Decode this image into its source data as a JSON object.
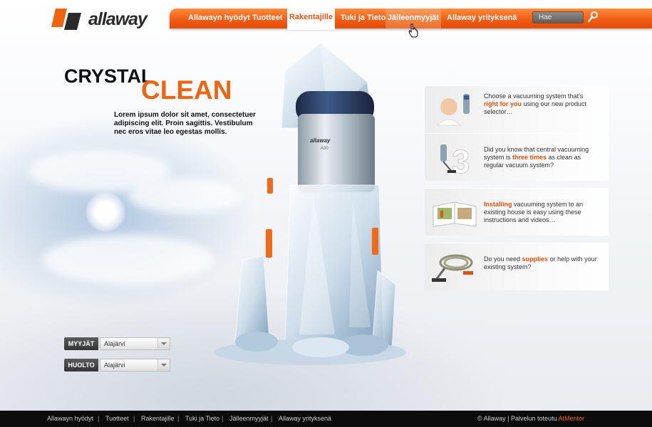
{
  "brand": {
    "name": "allaway"
  },
  "nav": {
    "items": [
      {
        "label": "Allawayn hyödyt"
      },
      {
        "label": "Tuotteet"
      },
      {
        "label": "Rakentajille"
      },
      {
        "label": "Tuki ja Tieto"
      },
      {
        "label": "Jälleenmyyjät"
      },
      {
        "label": "Allaway yrityksenä"
      }
    ],
    "active": "Rakentajille",
    "hover": "Jälleenmyyjät"
  },
  "search": {
    "placeholder": "Hae"
  },
  "hero": {
    "title_line1": "CRYSTAL",
    "title_line2": "CLEAN",
    "body": "Lorem ipsum dolor sit amet, consectetuer adipiscing elit. Proin sagittis. Vestibulum nec eros vitae leo egestas mollis.",
    "product_label": "allaway",
    "product_model": "A30"
  },
  "cards": [
    {
      "pre": "Choose a vacuuming system that's ",
      "highlight": "right for you",
      "post": " using our new product selector…",
      "icon": "child-icon"
    },
    {
      "pre": "Did you know that central vacuuming system is ",
      "highlight": "three times",
      "post": " as clean as regular vacuum system?",
      "icon": "number-three-icon"
    },
    {
      "pre": "",
      "highlight": "Installing",
      "post": " vacuuming system to an existing house is easy using these instructions and videos…",
      "icon": "book-icon"
    },
    {
      "pre": "Do you need ",
      "highlight": "supplies",
      "post": " or help with your existing system?",
      "icon": "hose-icon"
    }
  ],
  "selects": [
    {
      "label": "MYYJÄT",
      "value": "Alajärvi"
    },
    {
      "label": "HUOLTO",
      "value": "Alajärvi"
    }
  ],
  "footer": {
    "links": [
      "Allawayn hyödyt",
      "Tuotteet",
      "Rakentajille",
      "Tuki ja Tieto",
      "Jälleenmyyjät",
      "Allaway yrityksenä"
    ],
    "separator": "|",
    "copyright": "© Allaway",
    "made_by": "Palvelun toteutu",
    "made_by_brand": "AtMentor"
  },
  "colors": {
    "accent": "#f0640f",
    "nav": "#f05a12",
    "footer": "#0c0c0c"
  }
}
